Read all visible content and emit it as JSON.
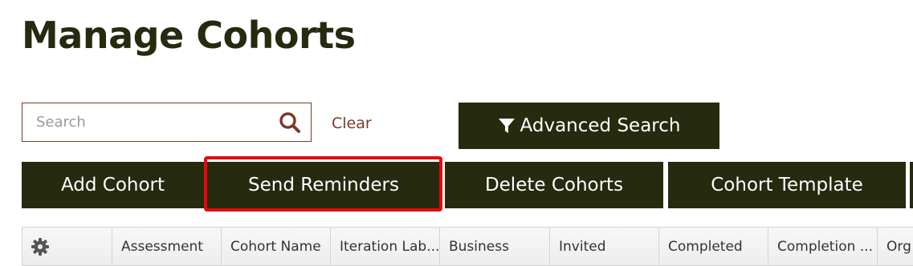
{
  "page": {
    "title": "Manage Cohorts"
  },
  "search": {
    "placeholder": "Search",
    "value": "",
    "clear_label": "Clear",
    "advanced_label": "Advanced Search"
  },
  "actions": {
    "add_label": "Add Cohort",
    "send_label": "Send Reminders",
    "delete_label": "Delete Cohorts",
    "template_label": "Cohort Template"
  },
  "table": {
    "columns": [
      "Assessment",
      "Cohort Name",
      "Iteration Lab...",
      "Business",
      "Invited",
      "Completed",
      "Completion ...",
      "Org"
    ]
  },
  "icons": {
    "search": "search-icon",
    "filter": "filter-icon",
    "settings": "gear-icon"
  },
  "colors": {
    "primary": "#262a0f",
    "accent": "#7a3a2a",
    "highlight": "#e3090d"
  }
}
